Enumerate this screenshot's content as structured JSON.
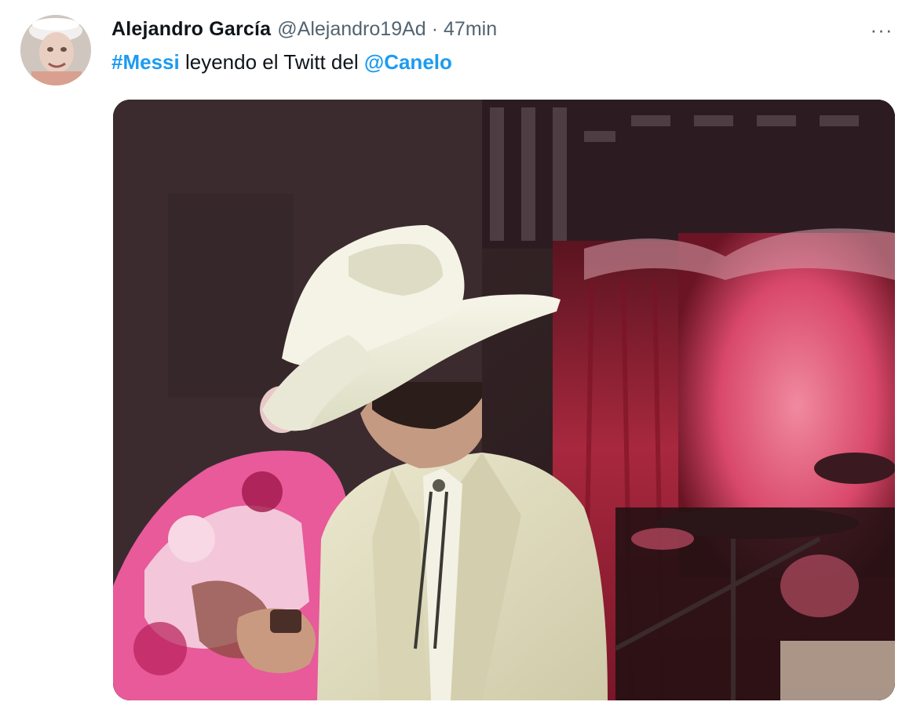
{
  "tweet": {
    "author": {
      "display_name": "Alejandro García",
      "handle": "@Alejandro19Ad",
      "avatar_icon": "user-avatar-photo"
    },
    "separator": "·",
    "time": "47min",
    "more_label": "···",
    "text": {
      "hashtag": "#Messi",
      "middle": " leyendo el Twitt del ",
      "mention": "@Canelo"
    },
    "media": {
      "type": "video-still",
      "icon": "media-photo"
    }
  },
  "colors": {
    "link": "#1d9bf0",
    "name": "#0f1419",
    "secondary": "#536471"
  }
}
